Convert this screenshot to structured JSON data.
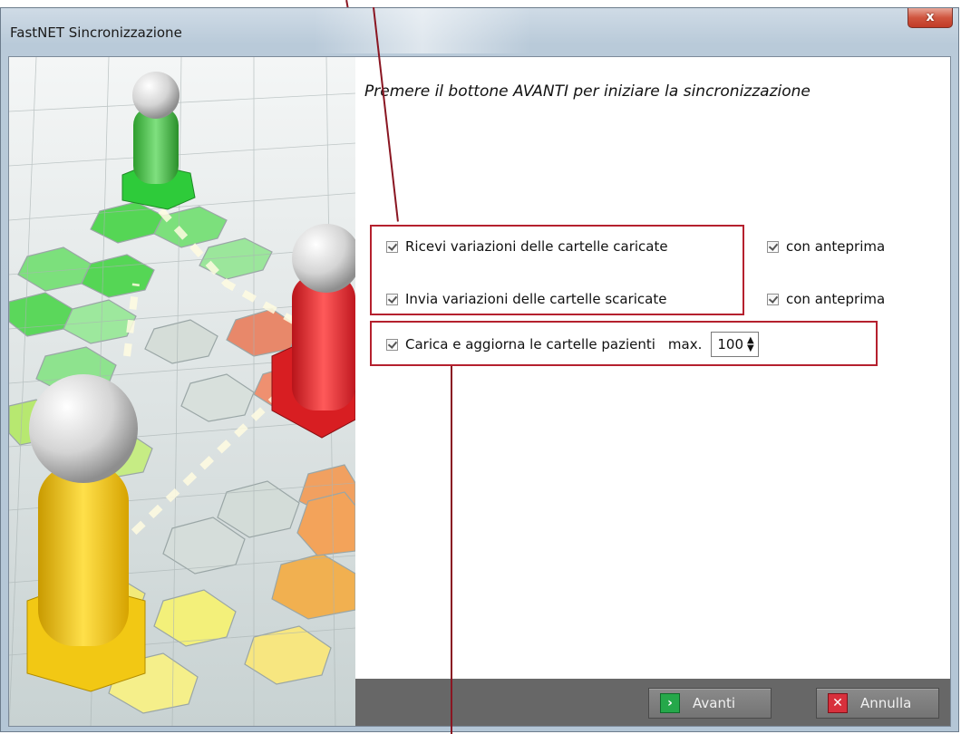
{
  "window": {
    "title": "FastNET Sincronizzazione",
    "close_label": "x"
  },
  "instruction": "Premere il bottone AVANTI per iniziare la sincronizzazione",
  "options": {
    "receive": {
      "label": "Ricevi variazioni delle cartelle caricate",
      "checked": true
    },
    "receive_preview": {
      "label": "con anteprima",
      "checked": true
    },
    "send": {
      "label": "Invia variazioni delle cartelle scaricate",
      "checked": true
    },
    "send_preview": {
      "label": "con anteprima",
      "checked": true
    },
    "load": {
      "label": "Carica e aggiorna le cartelle pazienti",
      "checked": true
    },
    "max_label": "max.",
    "max_value": "100"
  },
  "buttons": {
    "next_label": "Avanti",
    "cancel_label": "Annulla"
  },
  "colors": {
    "highlight": "#b5202e",
    "footer": "#676767",
    "next_icon": "#25a84a",
    "cancel_icon": "#d8303c"
  }
}
